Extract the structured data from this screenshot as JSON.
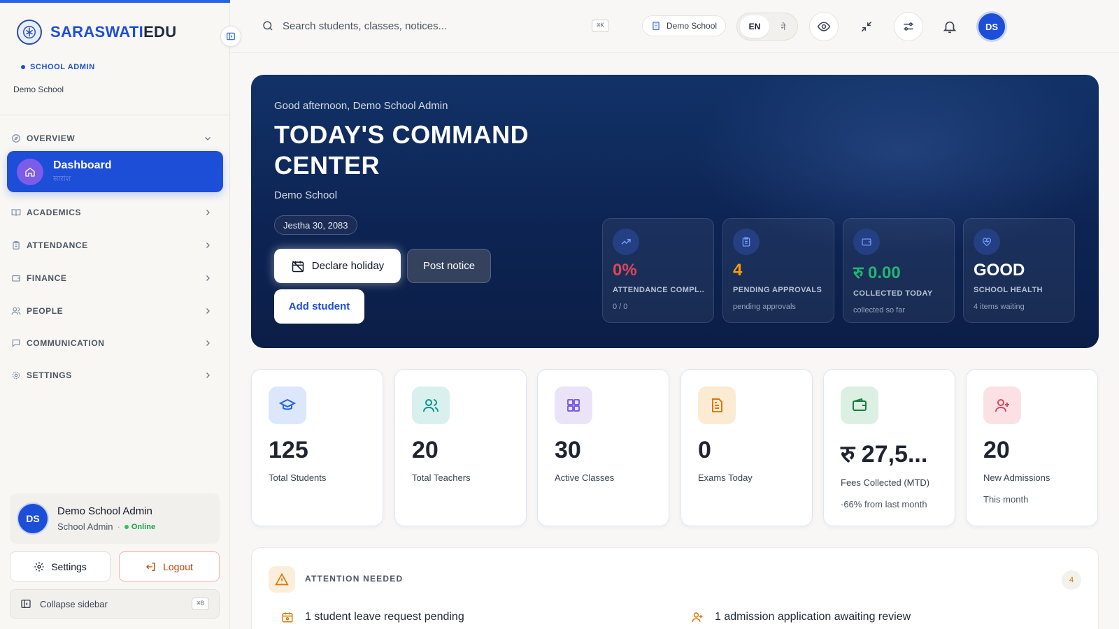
{
  "brand": {
    "part1": "SARASWATI",
    "part2": "EDU"
  },
  "sidebar": {
    "role": "SCHOOL ADMIN",
    "school": "Demo School",
    "active": {
      "label": "Dashboard",
      "sublabel": "सारांश"
    },
    "sections": [
      {
        "label": "OVERVIEW",
        "icon": "compass-icon"
      },
      {
        "label": "ACADEMICS",
        "icon": "book-icon"
      },
      {
        "label": "ATTENDANCE",
        "icon": "clipboard-icon"
      },
      {
        "label": "FINANCE",
        "icon": "wallet-icon"
      },
      {
        "label": "PEOPLE",
        "icon": "users-icon"
      },
      {
        "label": "COMMUNICATION",
        "icon": "message-icon"
      },
      {
        "label": "SETTINGS",
        "icon": "gear-icon"
      }
    ],
    "user": {
      "initials": "DS",
      "name": "Demo School Admin",
      "role": "School Admin",
      "status": "Online"
    },
    "settings_label": "Settings",
    "logout_label": "Logout",
    "collapse_label": "Collapse sidebar",
    "collapse_shortcut": "⌘B"
  },
  "topbar": {
    "search_placeholder": "Search students, classes, notices...",
    "search_shortcut": "⌘K",
    "school": "Demo School",
    "lang_en": "EN",
    "lang_ne": "ने",
    "avatar": "DS"
  },
  "hero": {
    "greeting": "Good afternoon, Demo School Admin",
    "title": "TODAY'S COMMAND CENTER",
    "school": "Demo School",
    "date": "Jestha 30, 2083",
    "declare_holiday": "Declare holiday",
    "post_notice": "Post notice",
    "add_student": "Add student",
    "kpis": [
      {
        "value": "0%",
        "label": "ATTENDANCE COMPL...",
        "sub": "0 / 0",
        "color": "#e0455a",
        "icon": "trend-up-icon"
      },
      {
        "value": "4",
        "label": "PENDING APPROVALS",
        "sub": "pending approvals",
        "color": "#f59e0b",
        "icon": "clipboard-icon"
      },
      {
        "value": "रु 0.00",
        "label": "COLLECTED TODAY",
        "sub": "collected so far",
        "color": "#22b573",
        "icon": "wallet-icon"
      },
      {
        "value": "GOOD",
        "label": "SCHOOL HEALTH",
        "sub": "4 items waiting",
        "color": "#ffffff",
        "icon": "heart-pulse-icon"
      }
    ]
  },
  "stats": [
    {
      "value": "125",
      "label": "Total Students",
      "sub": "",
      "icon": "graduation-cap-icon",
      "bg": "#dde7fb",
      "fg": "#2563eb"
    },
    {
      "value": "20",
      "label": "Total Teachers",
      "sub": "",
      "icon": "users-icon",
      "bg": "#d8f1ef",
      "fg": "#0d9488"
    },
    {
      "value": "30",
      "label": "Active Classes",
      "sub": "",
      "icon": "grid-icon",
      "bg": "#ebe4f8",
      "fg": "#7c5ce8"
    },
    {
      "value": "0",
      "label": "Exams Today",
      "sub": "",
      "icon": "document-icon",
      "bg": "#fcebd3",
      "fg": "#d97706"
    },
    {
      "value": "रु 27,5...",
      "label": "Fees Collected (MTD)",
      "sub": "-66% from last month",
      "icon": "wallet-icon",
      "bg": "#dcefe3",
      "fg": "#15803d"
    },
    {
      "value": "20",
      "label": "New Admissions",
      "sub": "This month",
      "icon": "user-plus-icon",
      "bg": "#fbe1e4",
      "fg": "#e0455a"
    }
  ],
  "attention": {
    "title": "ATTENTION NEEDED",
    "count": "4",
    "items": [
      {
        "text": "1 student leave request pending",
        "icon": "calendar-icon"
      },
      {
        "text": "1 admission application awaiting review",
        "icon": "user-plus-icon"
      }
    ]
  }
}
